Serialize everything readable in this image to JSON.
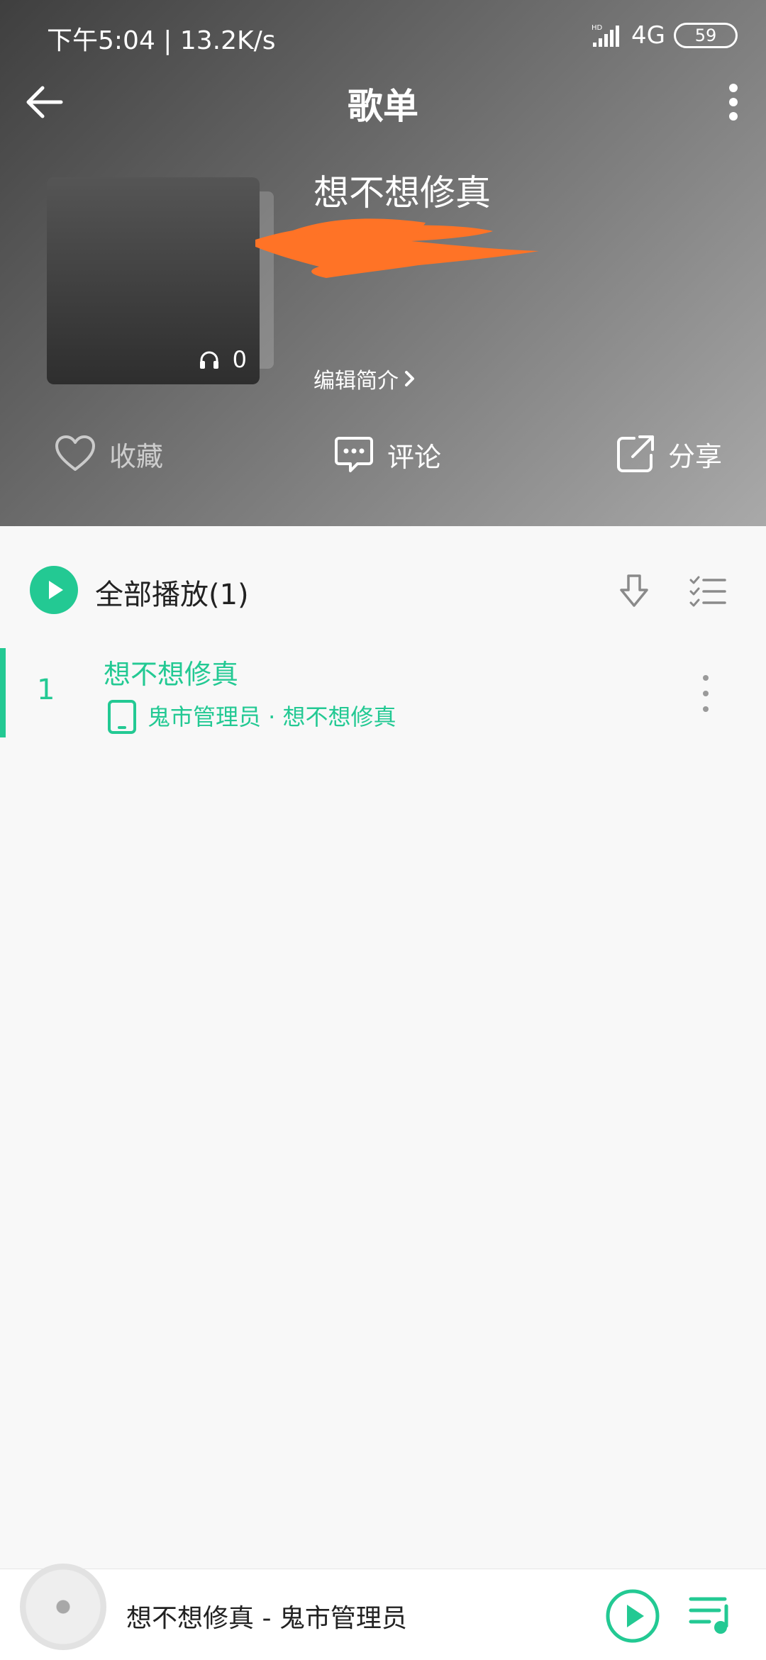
{
  "status_bar": {
    "time": "下午5:04",
    "speed": "13.2K/s",
    "network": "4G",
    "battery": "59"
  },
  "nav": {
    "title": "歌单"
  },
  "playlist": {
    "name": "想不想修真",
    "play_count": "0",
    "edit_intro": "编辑简介"
  },
  "actions": {
    "favorite": "收藏",
    "comment": "评论",
    "share": "分享"
  },
  "list_header": {
    "play_all": "全部播放(1)"
  },
  "songs": [
    {
      "index": "1",
      "title": "想不想修真",
      "subtitle": "鬼市管理员 · 想不想修真"
    }
  ],
  "mini_player": {
    "now_playing": "想不想修真 - 鬼市管理员"
  },
  "colors": {
    "accent": "#23c993",
    "scribble": "#ff7326"
  }
}
